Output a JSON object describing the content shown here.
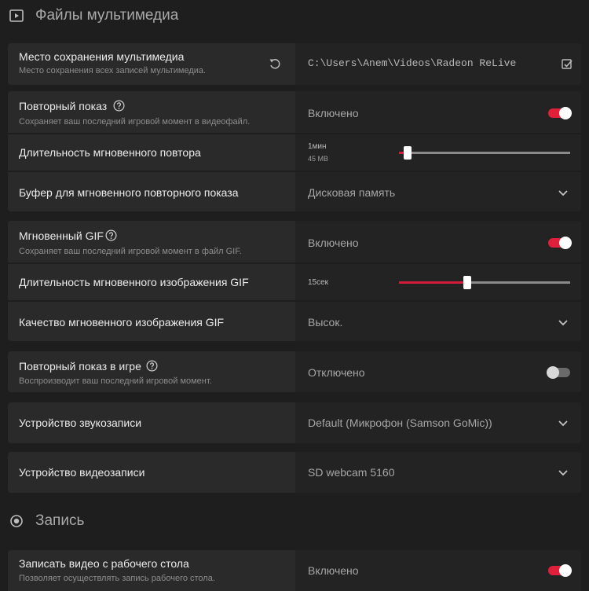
{
  "sections": {
    "media": {
      "title": "Файлы мультимедиа",
      "icon": "play-icon"
    },
    "record": {
      "title": "Запись",
      "icon": "record-icon"
    }
  },
  "media_location": {
    "label": "Место сохранения мультимедиа",
    "desc": "Место сохранения всех записей мультимедиа.",
    "value": "C:\\Users\\Anem\\Videos\\Radeon ReLive"
  },
  "instant_replay": {
    "label": "Повторный показ",
    "desc": "Сохраняет ваш последний игровой момент в видеофайл.",
    "value": "Включено",
    "on": true
  },
  "replay_duration": {
    "label": "Длительность мгновенного повтора",
    "value": "1мин",
    "size": "45 MB",
    "level": 0.05
  },
  "replay_buffer": {
    "label": "Буфер для мгновенного повторного показа",
    "value": "Дисковая память"
  },
  "instant_gif": {
    "label": "Мгновенный GIF",
    "desc": "Сохраняет ваш последний игровой момент в файл GIF.",
    "value": "Включено",
    "on": true
  },
  "gif_duration": {
    "label": "Длительность мгновенного изображения GIF",
    "value": "15сек",
    "level": 0.4
  },
  "gif_quality": {
    "label": "Качество мгновенного изображения GIF",
    "value": "Высок."
  },
  "ingame_replay": {
    "label": "Повторный показ в игре",
    "desc": "Воспроизводит ваш последний игровой момент.",
    "value": "Отключено",
    "on": false
  },
  "audio_device": {
    "label": "Устройство звукозаписи",
    "value": "Default (Микрофон (Samson GoMic))"
  },
  "video_device": {
    "label": "Устройство видеозаписи",
    "value": "SD webcam 5160"
  },
  "desktop_record": {
    "label": "Записать видео с рабочего стола",
    "desc": "Позволяет осуществлять запись рабочего стола.",
    "value": "Включено",
    "on": true
  },
  "colors": {
    "accent": "#e0203a",
    "background": "#1e1e1f",
    "card": "#2a2a2b",
    "control": "#232324"
  }
}
